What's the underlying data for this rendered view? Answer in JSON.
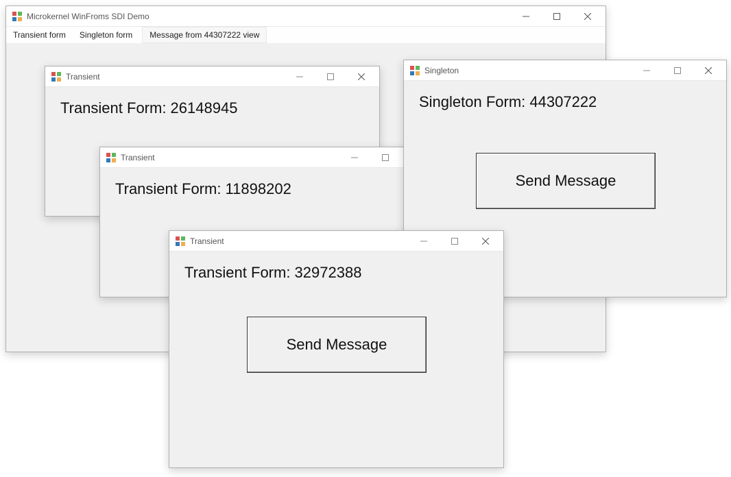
{
  "main": {
    "title": "Microkernel WinFroms SDI Demo",
    "menu": {
      "transient": "Transient form",
      "singleton": "Singleton form",
      "status": "Message from 44307222 view"
    }
  },
  "transient1": {
    "title": "Transient",
    "heading": "Transient Form: 26148945"
  },
  "transient2": {
    "title": "Transient",
    "heading": "Transient Form: 11898202"
  },
  "transient3": {
    "title": "Transient",
    "heading": "Transient Form: 32972388",
    "button": "Send Message"
  },
  "singleton": {
    "title": "Singleton",
    "heading": "Singleton Form: 44307222",
    "button": "Send Message"
  }
}
